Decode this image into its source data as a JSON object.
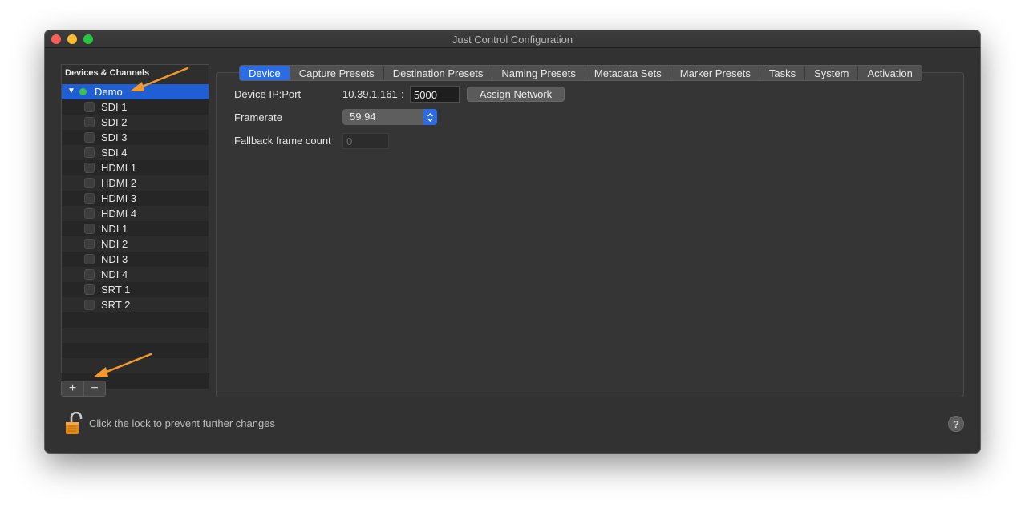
{
  "window": {
    "title": "Just Control Configuration"
  },
  "sidebar": {
    "header": "Devices & Channels",
    "device": {
      "label": "Demo",
      "status": "online",
      "status_color": "#3fc04c",
      "expanded": true
    },
    "channels": [
      {
        "label": "SDI 1"
      },
      {
        "label": "SDI 2"
      },
      {
        "label": "SDI 3"
      },
      {
        "label": "SDI 4"
      },
      {
        "label": "HDMI 1"
      },
      {
        "label": "HDMI 2"
      },
      {
        "label": "HDMI 3"
      },
      {
        "label": "HDMI 4"
      },
      {
        "label": "NDI 1"
      },
      {
        "label": "NDI 2"
      },
      {
        "label": "NDI 3"
      },
      {
        "label": "NDI 4"
      },
      {
        "label": "SRT 1"
      },
      {
        "label": "SRT 2"
      }
    ],
    "add_label": "+",
    "remove_label": "−"
  },
  "tabs": [
    {
      "label": "Device",
      "active": true
    },
    {
      "label": "Capture Presets"
    },
    {
      "label": "Destination Presets"
    },
    {
      "label": "Naming Presets"
    },
    {
      "label": "Metadata Sets"
    },
    {
      "label": "Marker Presets"
    },
    {
      "label": "Tasks"
    },
    {
      "label": "System"
    },
    {
      "label": "Activation"
    }
  ],
  "device_form": {
    "ip_label": "Device IP:Port",
    "ip_value": "10.39.1.161",
    "separator": ":",
    "port_value": "5000",
    "assign_button": "Assign Network",
    "framerate_label": "Framerate",
    "framerate_value": "59.94",
    "fallback_label": "Fallback frame count",
    "fallback_value": "0"
  },
  "footer": {
    "lock_text": "Click the lock to prevent further changes",
    "help_label": "?"
  },
  "colors": {
    "accent": "#2b6ce4",
    "selection": "#1f5fd3",
    "annotation_arrow": "#f39a2b"
  },
  "icons": [
    "close-icon",
    "minimize-icon",
    "maximize-icon",
    "disclosure-triangle-icon",
    "status-dot-icon",
    "lock-open-icon",
    "help-icon",
    "chevron-updown-icon"
  ]
}
